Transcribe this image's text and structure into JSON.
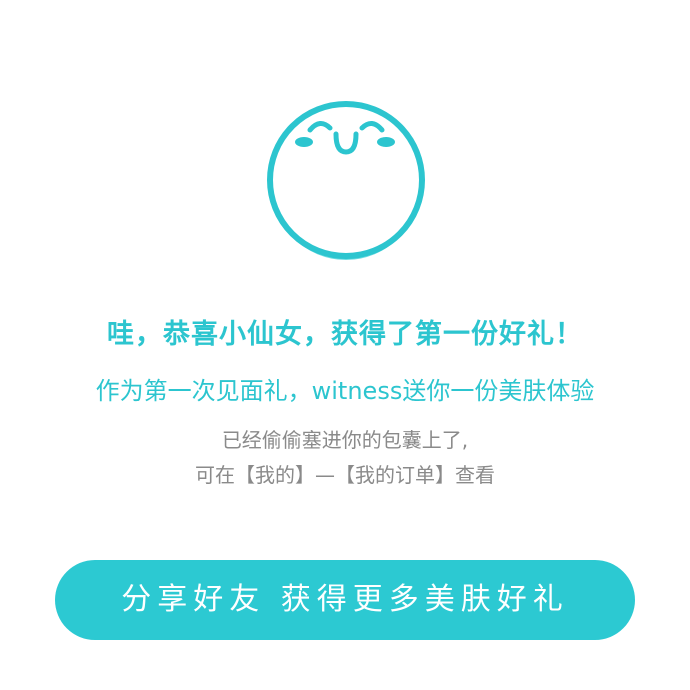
{
  "mascot": {
    "icon": "smiling-face-icon",
    "color": "#2cc5cf",
    "blush_color": "#2cc5cf"
  },
  "title": "哇，恭喜小仙女，获得了第一份好礼！",
  "subtitle": "作为第一次见面礼，witness送你一份美肤体验",
  "description": {
    "line1": "已经偷偷塞进你的包囊上了,",
    "line2": "可在【我的】—【我的订单】查看"
  },
  "share_button": {
    "label": "分享好友 获得更多美肤好礼"
  },
  "colors": {
    "accent": "#2cc5cf",
    "button": "#2cc9d2",
    "muted_text": "#8a8a8a",
    "background": "#ffffff"
  }
}
